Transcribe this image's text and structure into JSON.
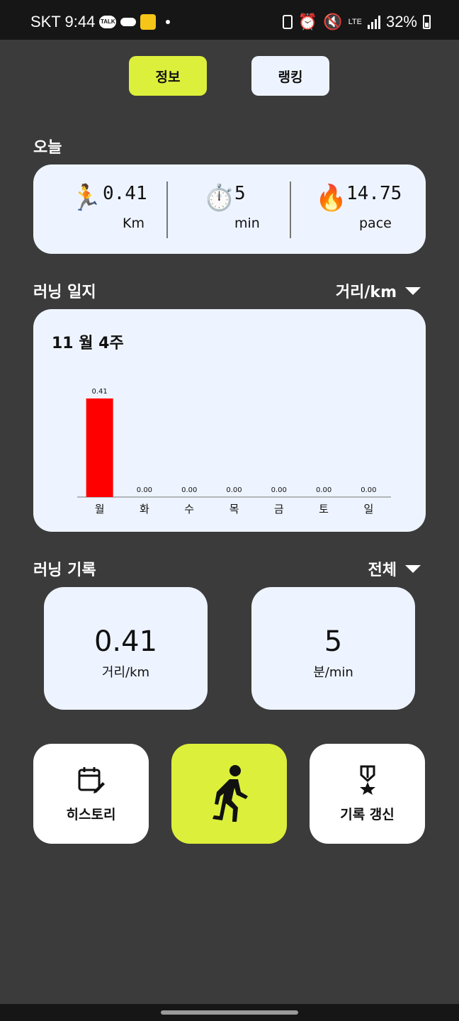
{
  "status_bar": {
    "carrier_time": "SKT 9:44",
    "talk_badge": "TALK",
    "network": "LTE",
    "battery": "32%"
  },
  "tabs": [
    {
      "label": "정보",
      "active": true
    },
    {
      "label": "랭킹",
      "active": false
    }
  ],
  "today": {
    "title": "오늘",
    "stats": [
      {
        "icon": "runner-icon",
        "value": "0.41",
        "unit": "Km"
      },
      {
        "icon": "stopwatch-icon",
        "value": "5",
        "unit": "min"
      },
      {
        "icon": "fire-icon",
        "value": "14.75",
        "unit": "pace"
      }
    ]
  },
  "journal": {
    "title": "러닝 일지",
    "dropdown_label": "거리/km",
    "week_label": "11 월 4주"
  },
  "chart_data": {
    "type": "bar",
    "categories": [
      "월",
      "화",
      "수",
      "목",
      "금",
      "토",
      "일"
    ],
    "values": [
      0.41,
      0.0,
      0.0,
      0.0,
      0.0,
      0.0,
      0.0
    ],
    "value_labels": [
      "0.41",
      "0.00",
      "0.00",
      "0.00",
      "0.00",
      "0.00",
      "0.00"
    ],
    "bar_color": "#ff0000",
    "title": "",
    "xlabel": "",
    "ylabel": "",
    "ylim": [
      0,
      0.41
    ],
    "grid": false
  },
  "records": {
    "title": "러닝 기록",
    "dropdown_label": "전체",
    "cards": [
      {
        "value": "0.41",
        "unit": "거리/km"
      },
      {
        "value": "5",
        "unit": "분/min"
      }
    ]
  },
  "bottom_buttons": {
    "history": "히스토리",
    "start": "",
    "record_update": "기록 갱신"
  },
  "colors": {
    "accent": "#dcef3b",
    "card_bg": "#eef4ff",
    "page_bg": "#3b3b3b"
  }
}
